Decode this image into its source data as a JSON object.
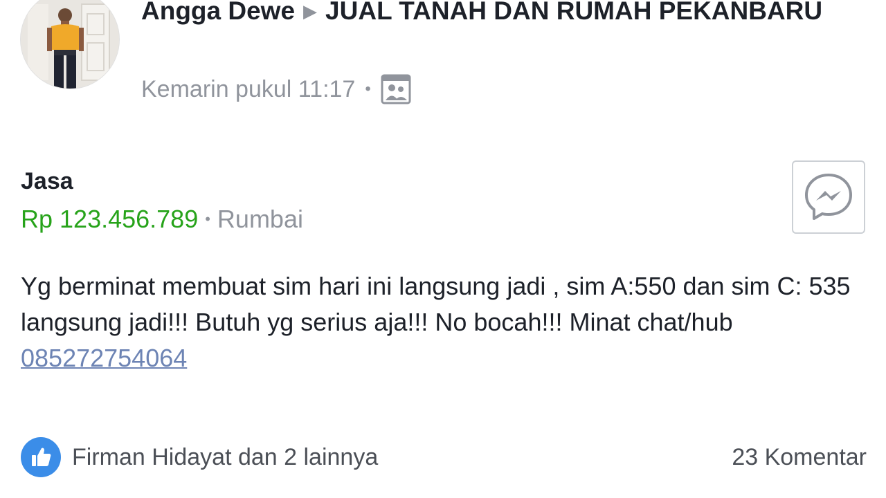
{
  "post": {
    "author": "Angga Dewe",
    "group": "JUAL TANAH DAN RUMAH PEKANBARU",
    "timestamp": "Kemarin pukul 11:17",
    "audience_icon": "group-photo-icon"
  },
  "listing": {
    "title": "Jasa",
    "price": "Rp 123.456.789",
    "location": "Rumbai",
    "description_text": "Yg berminat membuat sim hari ini langsung jadi , sim A:550 dan sim C: 535 langsung jadi!!! Butuh yg serius aja!!! No bocah!!! Minat chat/hub",
    "phone": "085272754064",
    "message_icon": "messenger-icon"
  },
  "footer": {
    "reactions_text": "Firman Hidayat dan 2 lainnya",
    "comments_text": "23 Komentar",
    "reaction_icon": "like-icon"
  },
  "colors": {
    "price": "#27a31a",
    "link": "#6d84b4",
    "muted": "#90949c",
    "like": "#3b8de8"
  }
}
